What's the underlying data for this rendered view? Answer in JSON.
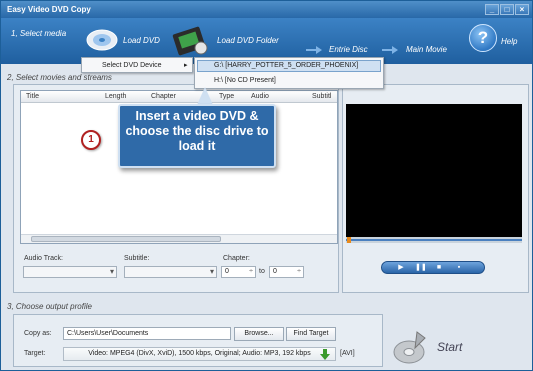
{
  "window": {
    "title": "Easy Video DVD Copy",
    "min": "_",
    "max": "□",
    "close": "×"
  },
  "toolbar": {
    "step1": "1, Select media",
    "load_dvd": "Load DVD",
    "load_dvd_folder": "Load DVD Folder",
    "entire_disc": "Entrie Disc",
    "main_movie": "Main Movie",
    "help": "Help",
    "help_glyph": "?"
  },
  "menu": {
    "select_dvd_device": "Select DVD Device",
    "arrow": "▸",
    "devices": [
      "G:\\ [HARRY_POTTER_5_ORDER_PHOENIX]",
      "H:\\ [No CD Present]"
    ]
  },
  "section2": "2, Select movies and streams",
  "list_columns": [
    "Title",
    "Length",
    "Chapter",
    "Type",
    "Audio",
    "Subtitl"
  ],
  "callout": {
    "step": "1",
    "text": "Insert a video DVD & choose the disc drive to load it"
  },
  "streams": {
    "audio_track_label": "Audio Track:",
    "subtitle_label": "Subtitle:",
    "chapter_label": "Chapter:",
    "chapter_from": "0",
    "to_label": "to",
    "chapter_to": "0"
  },
  "player": {
    "seek_position": 0.0,
    "controls": [
      "▶",
      "❚❚",
      "■",
      "▪"
    ]
  },
  "section3": "3, Choose output profile",
  "output": {
    "copy_as_label": "Copy as:",
    "copy_as_value": "C:\\Users\\User\\Documents",
    "browse": "Browse...",
    "find_target": "Find Target",
    "target_label": "Target:",
    "target_value": "Video: MPEG4 (DivX, XviD), 1500 kbps, Original; Audio: MP3, 192 kbps",
    "format": "[AVI]",
    "start": "Start"
  },
  "colors": {
    "accent": "#2f6aa8",
    "toolbar": "#2868a8",
    "step_ring": "#b02020"
  }
}
